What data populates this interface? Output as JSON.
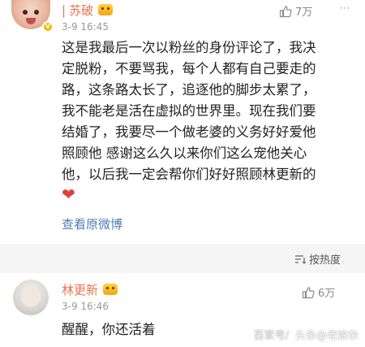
{
  "main_comment": {
    "author": "苏破",
    "timestamp": "3-9 16:45",
    "like_count": "7万",
    "body_lines": [
      "这是我最后一次以粉丝的身份评论了，我决",
      "定脱粉，不要骂我，每个人都有自己要走的",
      "路，这条路太长了，追逐他的脚步太累了，",
      "我不能老是活在虚拟的世界里。现在我们要",
      "结婚了，我要尽一个做老婆的义务好好爱他",
      "照顾他 感谢这么久以来你们这么宠他关心",
      "他，以后我一定会帮你们好好照顾林更新的"
    ],
    "heart": "❤",
    "view_source_label": "查看原微博"
  },
  "sort": {
    "label": "按热度"
  },
  "reply_comment": {
    "author": "林更新",
    "timestamp": "3-9 16:46",
    "like_count": "6万",
    "body": "醒醒，你还活着"
  },
  "watermark": {
    "faded": "百家号/",
    "text": "头条@老娘杂"
  },
  "colors": {
    "name": "#eb7350",
    "link": "#507daf",
    "heart": "#e0403c"
  },
  "icons": [
    "thumbs-up-icon",
    "more-icon",
    "sort-icon",
    "verified-badge-icon",
    "member-emoji-badge-icon"
  ]
}
